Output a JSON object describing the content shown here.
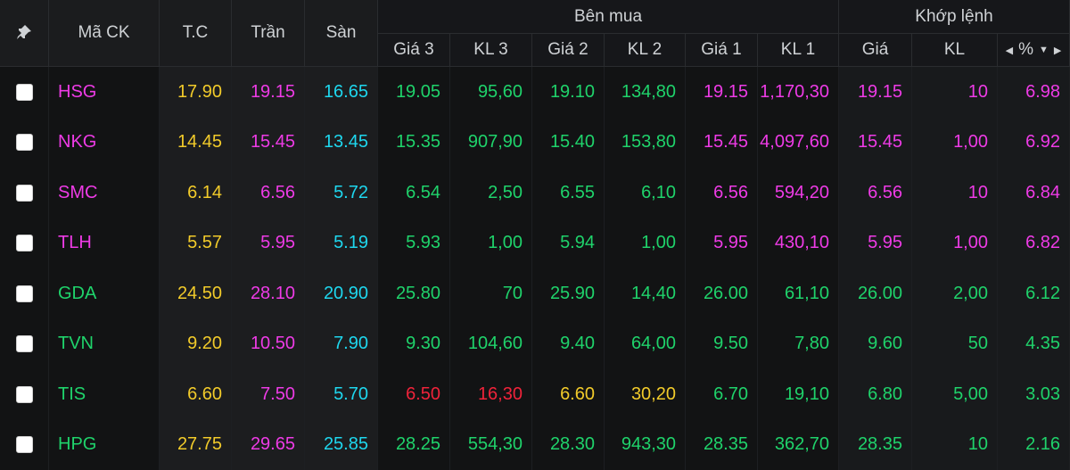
{
  "colors": {
    "yellow": "#f2cb2a",
    "pink": "#ee3be6",
    "cyan": "#1ed7ee",
    "green": "#1fd36b",
    "red": "#f0233a"
  },
  "headers": {
    "pin_icon": "pin-icon",
    "ticker": "Mã CK",
    "ref": "T.C",
    "ceiling": "Trần",
    "floor": "Sàn",
    "buy_group": "Bên mua",
    "match_group": "Khớp lệnh",
    "price3": "Giá 3",
    "vol3": "KL 3",
    "price2": "Giá 2",
    "vol2": "KL 2",
    "price1": "Giá 1",
    "vol1": "KL 1",
    "match_price": "Giá",
    "match_vol": "KL",
    "pct": "%",
    "pct_left_icon": "triangle-left-icon",
    "pct_down_icon": "triangle-down-icon",
    "pct_right_icon": "triangle-right-icon"
  },
  "rows": [
    {
      "ticker": "HSG",
      "ref": "17.90",
      "ceiling": "19.15",
      "floor": "16.65",
      "p3": "19.05",
      "v3": "95,60",
      "p2": "19.10",
      "v2": "134,80",
      "p1": "19.15",
      "v1": "1,170,30",
      "mp": "19.15",
      "mv": "10",
      "pct": "6.98",
      "colors": {
        "ticker": "pink",
        "p3": "green",
        "v3": "green",
        "p2": "green",
        "v2": "green",
        "p1": "pink",
        "v1": "pink",
        "mp": "pink",
        "mv": "pink",
        "pct": "pink"
      }
    },
    {
      "ticker": "NKG",
      "ref": "14.45",
      "ceiling": "15.45",
      "floor": "13.45",
      "p3": "15.35",
      "v3": "907,90",
      "p2": "15.40",
      "v2": "153,80",
      "p1": "15.45",
      "v1": "4,097,60",
      "mp": "15.45",
      "mv": "1,00",
      "pct": "6.92",
      "colors": {
        "ticker": "pink",
        "p3": "green",
        "v3": "green",
        "p2": "green",
        "v2": "green",
        "p1": "pink",
        "v1": "pink",
        "mp": "pink",
        "mv": "pink",
        "pct": "pink"
      }
    },
    {
      "ticker": "SMC",
      "ref": "6.14",
      "ceiling": "6.56",
      "floor": "5.72",
      "p3": "6.54",
      "v3": "2,50",
      "p2": "6.55",
      "v2": "6,10",
      "p1": "6.56",
      "v1": "594,20",
      "mp": "6.56",
      "mv": "10",
      "pct": "6.84",
      "colors": {
        "ticker": "pink",
        "p3": "green",
        "v3": "green",
        "p2": "green",
        "v2": "green",
        "p1": "pink",
        "v1": "pink",
        "mp": "pink",
        "mv": "pink",
        "pct": "pink"
      }
    },
    {
      "ticker": "TLH",
      "ref": "5.57",
      "ceiling": "5.95",
      "floor": "5.19",
      "p3": "5.93",
      "v3": "1,00",
      "p2": "5.94",
      "v2": "1,00",
      "p1": "5.95",
      "v1": "430,10",
      "mp": "5.95",
      "mv": "1,00",
      "pct": "6.82",
      "colors": {
        "ticker": "pink",
        "p3": "green",
        "v3": "green",
        "p2": "green",
        "v2": "green",
        "p1": "pink",
        "v1": "pink",
        "mp": "pink",
        "mv": "pink",
        "pct": "pink"
      }
    },
    {
      "ticker": "GDA",
      "ref": "24.50",
      "ceiling": "28.10",
      "floor": "20.90",
      "p3": "25.80",
      "v3": "70",
      "p2": "25.90",
      "v2": "14,40",
      "p1": "26.00",
      "v1": "61,10",
      "mp": "26.00",
      "mv": "2,00",
      "pct": "6.12",
      "colors": {
        "ticker": "green",
        "p3": "green",
        "v3": "green",
        "p2": "green",
        "v2": "green",
        "p1": "green",
        "v1": "green",
        "mp": "green",
        "mv": "green",
        "pct": "green"
      }
    },
    {
      "ticker": "TVN",
      "ref": "9.20",
      "ceiling": "10.50",
      "floor": "7.90",
      "p3": "9.30",
      "v3": "104,60",
      "p2": "9.40",
      "v2": "64,00",
      "p1": "9.50",
      "v1": "7,80",
      "mp": "9.60",
      "mv": "50",
      "pct": "4.35",
      "colors": {
        "ticker": "green",
        "p3": "green",
        "v3": "green",
        "p2": "green",
        "v2": "green",
        "p1": "green",
        "v1": "green",
        "mp": "green",
        "mv": "green",
        "pct": "green"
      }
    },
    {
      "ticker": "TIS",
      "ref": "6.60",
      "ceiling": "7.50",
      "floor": "5.70",
      "p3": "6.50",
      "v3": "16,30",
      "p2": "6.60",
      "v2": "30,20",
      "p1": "6.70",
      "v1": "19,10",
      "mp": "6.80",
      "mv": "5,00",
      "pct": "3.03",
      "colors": {
        "ticker": "green",
        "p3": "red",
        "v3": "red",
        "p2": "yellow",
        "v2": "yellow",
        "p1": "green",
        "v1": "green",
        "mp": "green",
        "mv": "green",
        "pct": "green"
      }
    },
    {
      "ticker": "HPG",
      "ref": "27.75",
      "ceiling": "29.65",
      "floor": "25.85",
      "p3": "28.25",
      "v3": "554,30",
      "p2": "28.30",
      "v2": "943,30",
      "p1": "28.35",
      "v1": "362,70",
      "mp": "28.35",
      "mv": "10",
      "pct": "2.16",
      "colors": {
        "ticker": "green",
        "p3": "green",
        "v3": "green",
        "p2": "green",
        "v2": "green",
        "p1": "green",
        "v1": "green",
        "mp": "green",
        "mv": "green",
        "pct": "green"
      }
    }
  ]
}
